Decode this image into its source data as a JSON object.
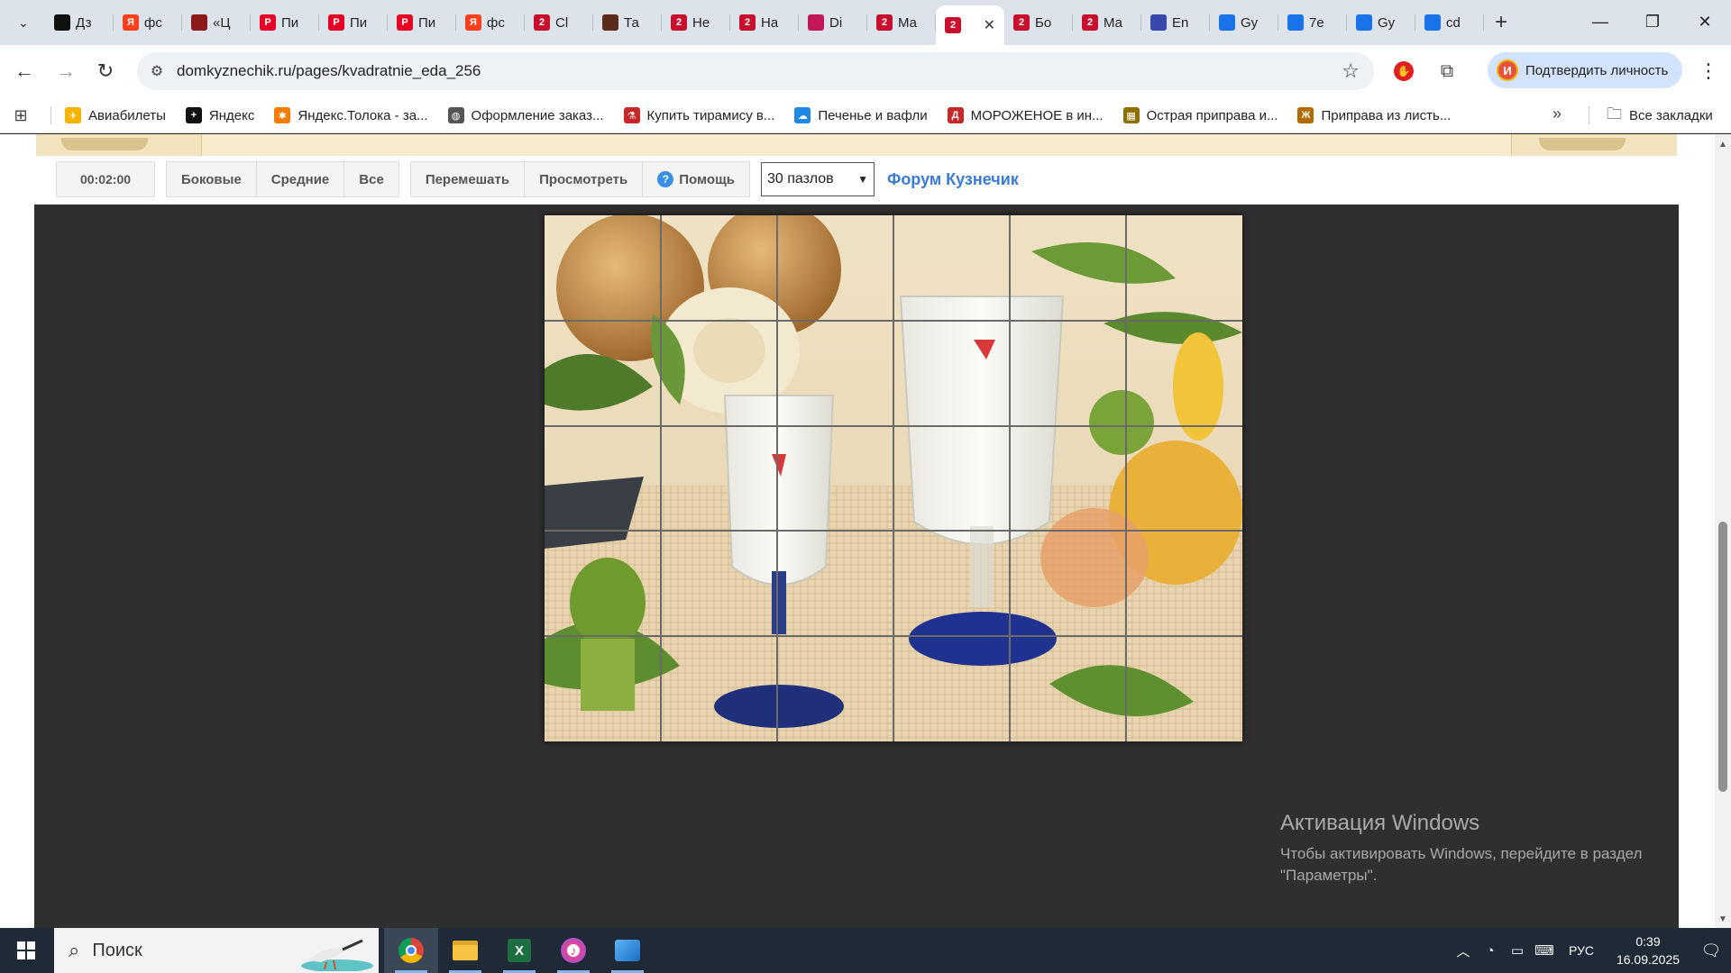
{
  "browser": {
    "tabs": [
      {
        "label": "Дз",
        "icon": "plus-dark-icon",
        "color": "#111111"
      },
      {
        "label": "фс",
        "icon": "yandex-icon",
        "color": "#fc3f1d"
      },
      {
        "label": "«Ц",
        "icon": "site-icon",
        "color": "#8b1a1a"
      },
      {
        "label": "Пи",
        "icon": "pinterest-icon",
        "color": "#e60023"
      },
      {
        "label": "Пи",
        "icon": "pinterest-icon",
        "color": "#e60023"
      },
      {
        "label": "Пи",
        "icon": "pinterest-icon",
        "color": "#e60023"
      },
      {
        "label": "фс",
        "icon": "yandex-icon",
        "color": "#fc3f1d"
      },
      {
        "label": "Сl",
        "icon": "domkyznechik-icon",
        "color": "#c8102e"
      },
      {
        "label": "Та",
        "icon": "site-icon",
        "color": "#5a2a1a"
      },
      {
        "label": "Не",
        "icon": "domkyznechik-icon",
        "color": "#c8102e"
      },
      {
        "label": "На",
        "icon": "domkyznechik-icon",
        "color": "#c8102e"
      },
      {
        "label": "Di",
        "icon": "flower-icon",
        "color": "#c2185b"
      },
      {
        "label": "Ма",
        "icon": "domkyznechik-icon",
        "color": "#c8102e"
      },
      {
        "label": "",
        "icon": "domkyznechik-icon",
        "color": "#c8102e",
        "active": true
      },
      {
        "label": "Бо",
        "icon": "domkyznechik-icon",
        "color": "#c8102e"
      },
      {
        "label": "Ма",
        "icon": "domkyznechik-icon",
        "color": "#c8102e"
      },
      {
        "label": "En",
        "icon": "wizard-icon",
        "color": "#3949ab"
      },
      {
        "label": "Gy",
        "icon": "translate-icon",
        "color": "#1a73e8"
      },
      {
        "label": "7е",
        "icon": "translate-icon",
        "color": "#1a73e8"
      },
      {
        "label": "Gy",
        "icon": "translate-icon",
        "color": "#1a73e8"
      },
      {
        "label": "cd",
        "icon": "translate-icon",
        "color": "#1a73e8"
      }
    ],
    "url": "domkyznechik.ru/pages/kvadratnie_eda_256",
    "profile_label": "Подтвердить личность",
    "profile_initial": "И",
    "bookmarks": [
      {
        "label": "Авиабилеты",
        "color": "#f4b400",
        "glyph": "✈"
      },
      {
        "label": "Яндекс",
        "color": "#111111",
        "glyph": "+"
      },
      {
        "label": "Яндекс.Толока - за...",
        "color": "#f57c00",
        "glyph": "✱"
      },
      {
        "label": "Оформление заказ...",
        "color": "#555555",
        "glyph": "◍"
      },
      {
        "label": "Купить тирамису в...",
        "color": "#c62828",
        "glyph": "⚗"
      },
      {
        "label": "Печенье и вафли",
        "color": "#1e88e5",
        "glyph": "☁"
      },
      {
        "label": "МОРОЖЕНОЕ в ин...",
        "color": "#c62828",
        "glyph": "Д"
      },
      {
        "label": "Острая приправа и...",
        "color": "#8d6e00",
        "glyph": "▦"
      },
      {
        "label": "Приправа из листь...",
        "color": "#b26a00",
        "glyph": "Ж"
      }
    ],
    "all_bookmarks": "Все закладки"
  },
  "puzzle": {
    "timer": "00:02:00",
    "mode_buttons": [
      "Боковые",
      "Средние",
      "Все"
    ],
    "action_buttons": {
      "shuffle": "Перемешать",
      "preview": "Просмотреть",
      "help": "Помощь"
    },
    "pieces_select": "30 пазлов",
    "forum_link": "Форум Кузнечик",
    "grid": {
      "cols": 6,
      "rows": 5
    }
  },
  "watermark": {
    "title": "Активация Windows",
    "line1": "Чтобы активировать Windows, перейдите в раздел",
    "line2": "\"Параметры\"."
  },
  "taskbar": {
    "search_placeholder": "Поиск",
    "apps": [
      "chrome-icon",
      "file-explorer-icon",
      "excel-icon",
      "itunes-icon",
      "paint-icon"
    ],
    "language": "РУС",
    "time": "0:39",
    "date": "16.09.2025"
  }
}
